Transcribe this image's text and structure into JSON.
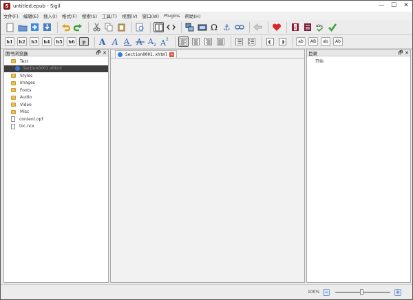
{
  "window": {
    "title": "untitled.epub - Sigil",
    "minimize": "—",
    "maximize": "☐",
    "close": "✕"
  },
  "menu": [
    {
      "label": "文件(F)"
    },
    {
      "label": "编辑(E)"
    },
    {
      "label": "插入(I)"
    },
    {
      "label": "格式(F)"
    },
    {
      "label": "搜索(S)"
    },
    {
      "label": "工具(T)"
    },
    {
      "label": "视图(V)"
    },
    {
      "label": "窗口(W)"
    },
    {
      "label": "Plugins"
    },
    {
      "label": "帮助(H)"
    }
  ],
  "toolbar2": {
    "headings": [
      "h1",
      "h2",
      "h3",
      "h4",
      "h5",
      "h6",
      "p"
    ],
    "active_heading": "p",
    "style_buttons": [
      "ab",
      "AB",
      "ab",
      "Ab"
    ]
  },
  "book_browser": {
    "title": "图书浏览器",
    "items": [
      {
        "label": "Text",
        "kind": "folder",
        "indent": 1
      },
      {
        "label": "Section0001.xhtml",
        "kind": "xhtml",
        "indent": 2,
        "selected": true
      },
      {
        "label": "Styles",
        "kind": "folder",
        "indent": 1
      },
      {
        "label": "Images",
        "kind": "folder",
        "indent": 1
      },
      {
        "label": "Fonts",
        "kind": "folder",
        "indent": 1
      },
      {
        "label": "Audio",
        "kind": "folder",
        "indent": 1
      },
      {
        "label": "Video",
        "kind": "folder",
        "indent": 1
      },
      {
        "label": "Misc",
        "kind": "folder",
        "indent": 1
      },
      {
        "label": "content.opf",
        "kind": "file",
        "indent": 1
      },
      {
        "label": "toc.ncx",
        "kind": "file",
        "indent": 1
      }
    ]
  },
  "editor": {
    "tab_label": "Section0001.xhtml"
  },
  "toc": {
    "title": "目录",
    "items": [
      "开始"
    ]
  },
  "status": {
    "zoom": "100%",
    "zoom_out": "−",
    "zoom_in": "+",
    "zoom_level": 0.5
  },
  "panel_controls": {
    "float": "🗗",
    "close": "✕"
  },
  "colors": {
    "accent": "#3a7bd5",
    "heart": "#d9272e",
    "undo": "#e0a020",
    "redo": "#3aa03a",
    "check": "#3aa03a"
  }
}
